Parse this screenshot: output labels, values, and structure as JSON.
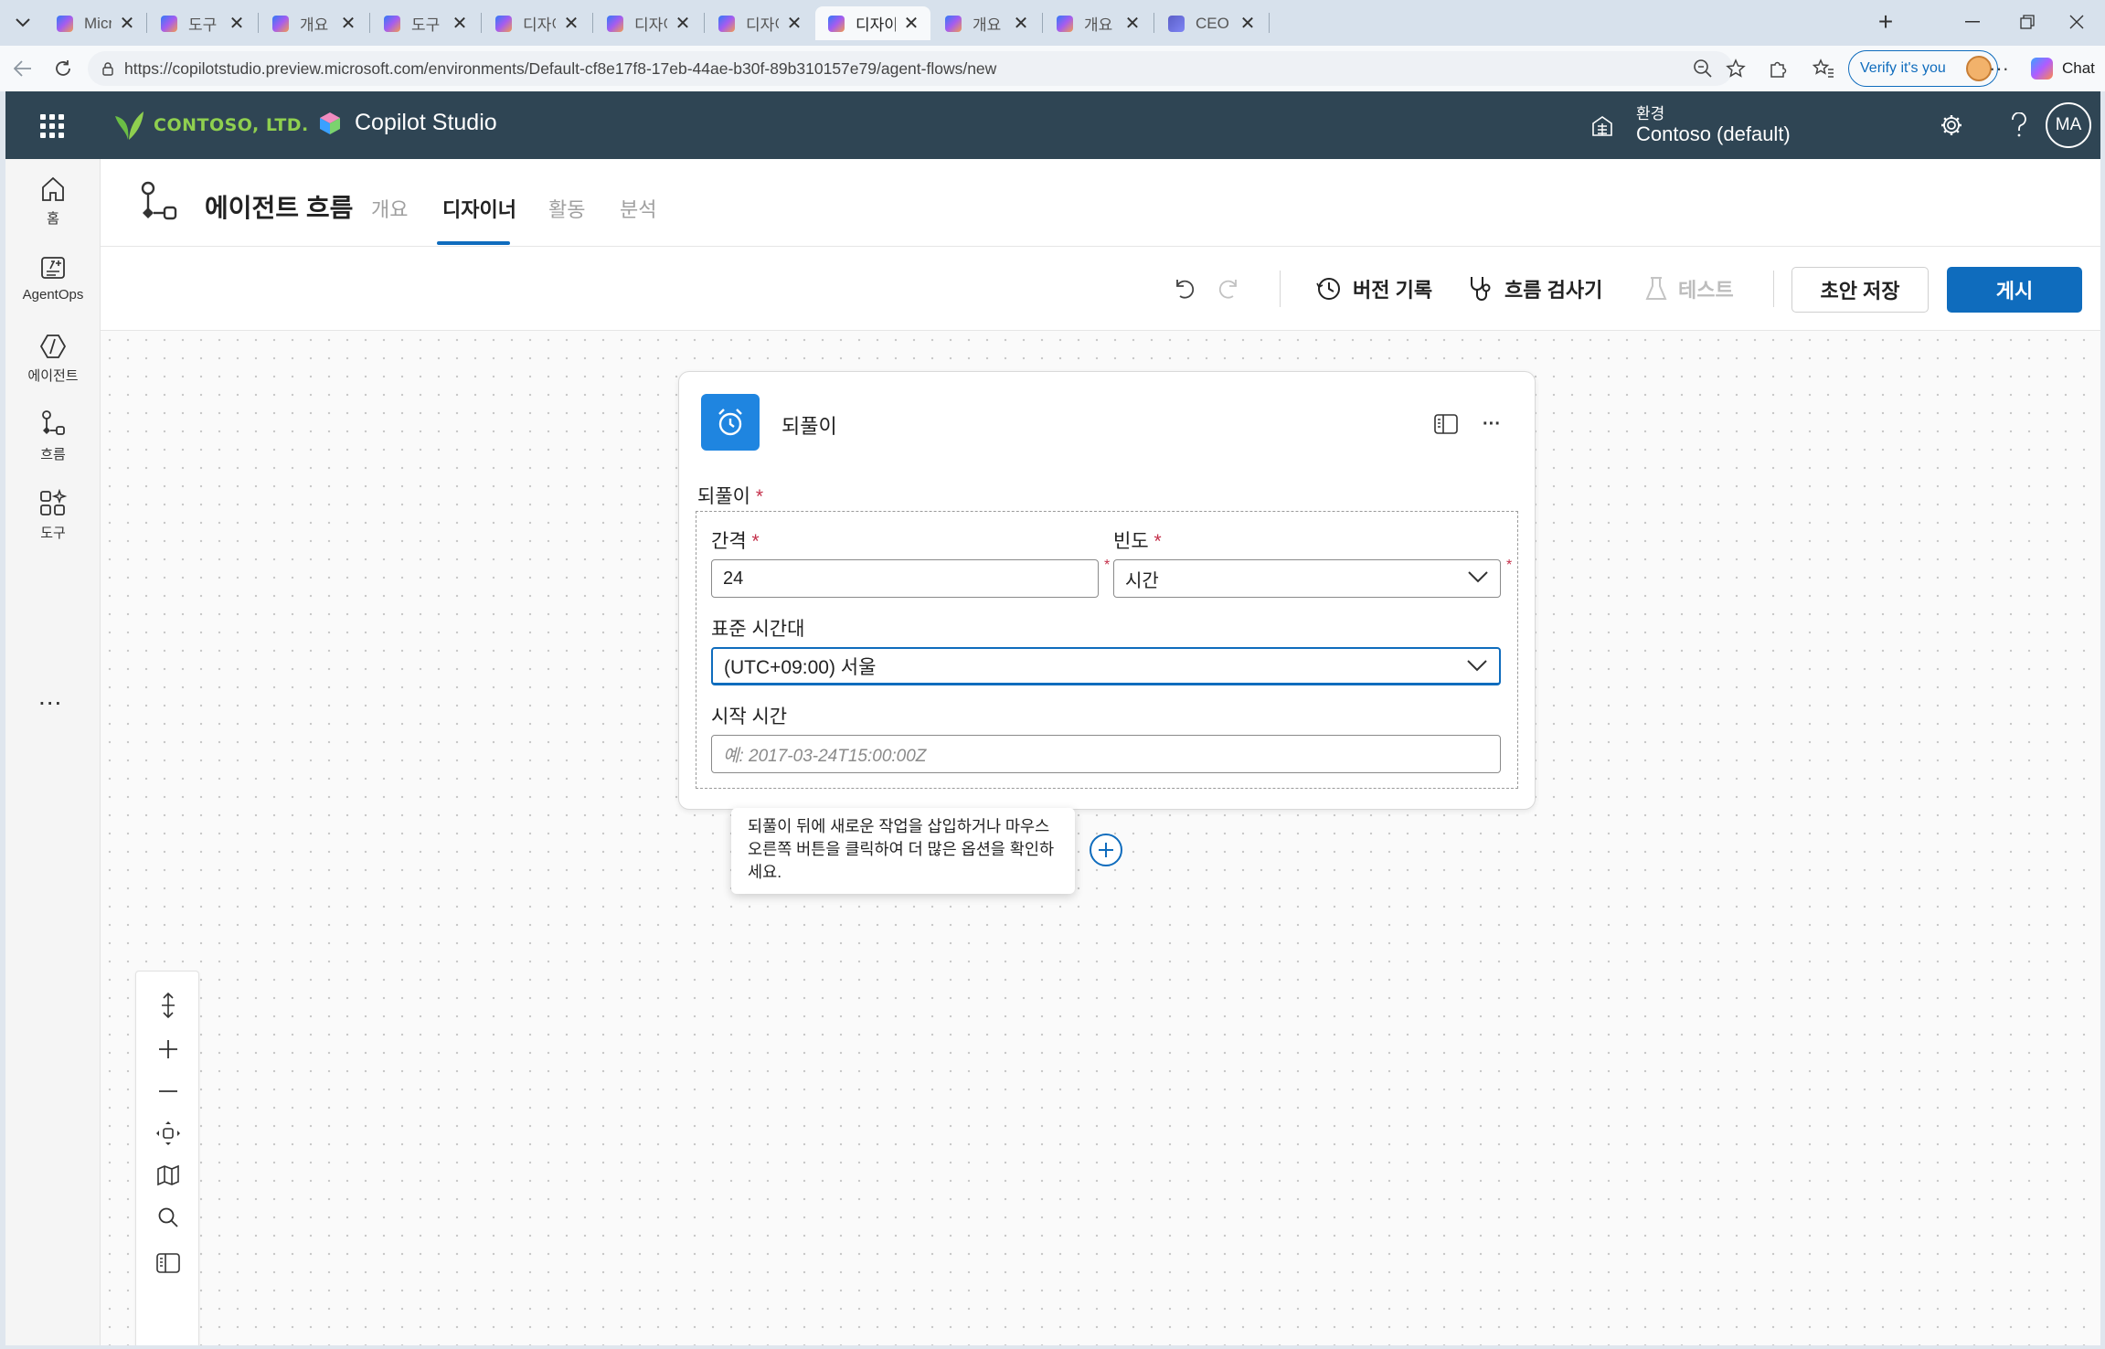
{
  "browser": {
    "tabs": [
      {
        "title": "Microsoft Copilo",
        "active": false
      },
      {
        "title": "도구 - CEO Staff",
        "active": false
      },
      {
        "title": "개요 - Microsoft",
        "active": false
      },
      {
        "title": "도구 - CEO Staff",
        "active": false
      },
      {
        "title": "디자이너 - Micro",
        "active": false
      },
      {
        "title": "디자이너 - Micro",
        "active": false
      },
      {
        "title": "디자이너 - Micro",
        "active": false
      },
      {
        "title": "디자이너 - Micro",
        "active": true
      },
      {
        "title": "개요 - CEO Staff",
        "active": false
      },
      {
        "title": "개요 - CEO Staff",
        "active": false
      },
      {
        "title": "CEO Staff | Micro",
        "active": false
      }
    ],
    "url": "https://copilotstudio.preview.microsoft.com/environments/Default-cf8e17f8-17eb-44ae-b30f-89b310157e79/agent-flows/new",
    "verify_label": "Verify it's you",
    "chat_label": "Chat"
  },
  "header": {
    "org_logo_text": "CONTOSO, LTD.",
    "product_name": "Copilot Studio",
    "env_label": "환경",
    "env_value": "Contoso (default)",
    "avatar_initials": "MA"
  },
  "rail": {
    "items": [
      {
        "label": "홈",
        "icon": "home-icon"
      },
      {
        "label": "AgentOps",
        "icon": "agentops-icon"
      },
      {
        "label": "에이전트",
        "icon": "agent-icon"
      },
      {
        "label": "흐름",
        "icon": "flow-icon"
      },
      {
        "label": "도구",
        "icon": "tools-icon"
      }
    ],
    "more": "..."
  },
  "page": {
    "title": "에이전트 흐름",
    "tabs": [
      {
        "label": "개요",
        "active": false
      },
      {
        "label": "디자이너",
        "active": true
      },
      {
        "label": "활동",
        "active": false
      },
      {
        "label": "분석",
        "active": false
      }
    ]
  },
  "toolbar": {
    "version_history": "버전 기록",
    "flow_checker": "흐름 검사기",
    "test": "테스트",
    "save_draft": "초안 저장",
    "publish": "게시"
  },
  "card": {
    "title": "되풀이",
    "section_label": "되풀이",
    "interval_label": "간격",
    "interval_value": "24",
    "frequency_label": "빈도",
    "frequency_value": "시간",
    "timezone_label": "표준 시간대",
    "timezone_value": "(UTC+09:00) 서울",
    "start_time_label": "시작 시간",
    "start_time_placeholder": "예: 2017-03-24T15:00:00Z",
    "required_mark": "*"
  },
  "tooltip": {
    "text": "되풀이 뒤에 새로운 작업을 삽입하거나 마우스 오른쪽 버튼을 클릭하여 더 많은 옵션을 확인하세요."
  },
  "colors": {
    "header_bg": "#2f4554",
    "accent": "#0f6cbd",
    "card_icon_bg": "#1f85e0",
    "required": "#c4314b"
  }
}
